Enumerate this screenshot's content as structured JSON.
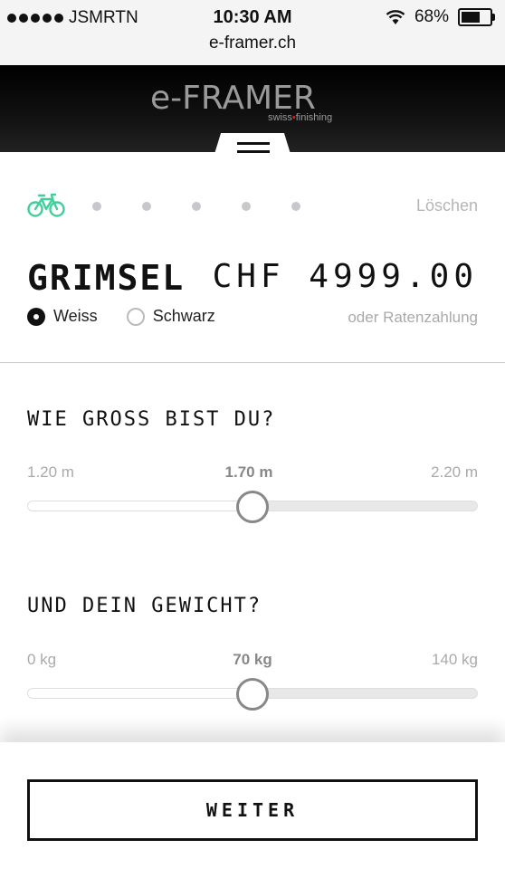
{
  "status_bar": {
    "carrier": "JSMRTN",
    "time": "10:30 AM",
    "battery": "68%",
    "battery_level": 0.68,
    "url": "e-framer.ch"
  },
  "header": {
    "logo_main": "e-FRAMER",
    "logo_sub_left": "swiss",
    "logo_sub_right": "finishing",
    "menu_icon": "hamburger-menu-icon"
  },
  "steps": {
    "icon": "bicycle-icon",
    "icon_color": "#3fcf9a",
    "count": 5,
    "clear_label": "Löschen"
  },
  "product": {
    "name": "GRIMSEL",
    "price": "CHF 4999.00",
    "colors": [
      {
        "label": "Weiss",
        "selected": true
      },
      {
        "label": "Schwarz",
        "selected": false
      }
    ],
    "financing": "oder Ratenzahlung"
  },
  "height": {
    "question": "WIE GROSS BIST DU?",
    "min": "1.20 m",
    "value": "1.70 m",
    "max": "2.20 m",
    "level": 0.5
  },
  "weight": {
    "question": "UND DEIN GEWICHT?",
    "min": "0 kg",
    "value": "70 kg",
    "max": "140 kg",
    "level": 0.5
  },
  "footer": {
    "next_label": "WEITER"
  }
}
